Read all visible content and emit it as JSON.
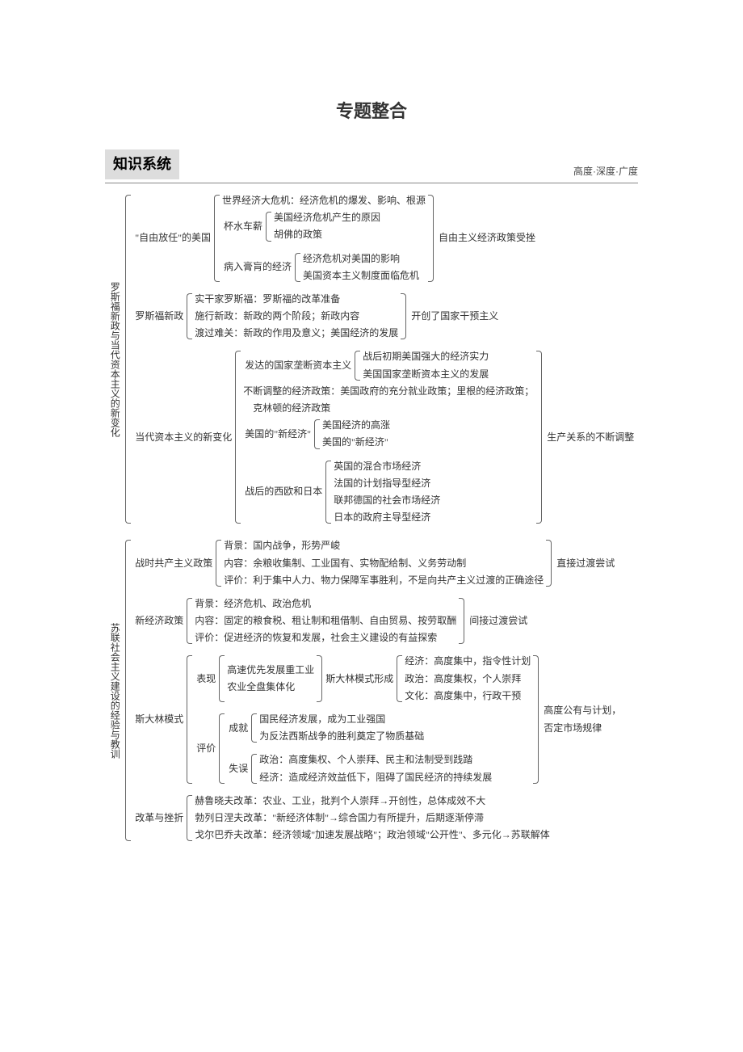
{
  "title": "专题整合",
  "section": {
    "label": "知识系统",
    "sub": "高度·深度·广度"
  },
  "us": {
    "root": "罗斯福新政与当代资本主义的新变化",
    "laissez": {
      "label": "\"自由放任\"的美国",
      "crisis": "世界经济大危机：经济危机的爆发、影响、根源",
      "cup": {
        "label": "杯水车薪",
        "a": "美国经济危机产生的原因",
        "b": "胡佛的政策"
      },
      "sick": {
        "label": "病入膏肓的经济",
        "a": "经济危机对美国的影响",
        "b": "美国资本主义制度面临危机"
      },
      "result": "自由主义经济政策受挫"
    },
    "newdeal": {
      "label": "罗斯福新政",
      "a": "实干家罗斯福：罗斯福的改革准备",
      "b": "施行新政：新政的两个阶段；新政内容",
      "c": "渡过难关：新政的作用及意义；美国经济的发展",
      "result": "开创了国家干预主义"
    },
    "modern": {
      "label": "当代资本主义的新变化",
      "monopoly": {
        "label": "发达的国家垄断资本主义",
        "a": "战后初期美国强大的经济实力",
        "b": "美国国家垄断资本主义的发展"
      },
      "adjust": "不断调整的经济政策：美国政府的充分就业政策；里根的经济政策；",
      "clinton": "克林顿的经济政策",
      "neweco": {
        "label": "美国的\"新经济\"",
        "a": "美国经济的高涨",
        "b": "美国的\"新经济\""
      },
      "postwar": {
        "label": "战后的西欧和日本",
        "a": "英国的混合市场经济",
        "b": "法国的计划指导型经济",
        "c": "联邦德国的社会市场经济",
        "d": "日本的政府主导型经济"
      },
      "result": "生产关系的不断调整"
    }
  },
  "ussr": {
    "root": "苏联社会主义建设的经验与教训",
    "war": {
      "label": "战时共产主义政策",
      "a": "背景：国内战争，形势严峻",
      "b": "内容：余粮收集制、工业国有、实物配给制、义务劳动制",
      "c": "评价：利于集中人力、物力保障军事胜利，不是向共产主义过渡的正确途径",
      "result": "直接过渡尝试"
    },
    "nep": {
      "label": "新经济政策",
      "a": "背景：经济危机、政治危机",
      "b": "内容：固定的粮食税、租让制和租借制、自由贸易、按劳取酬",
      "c": "评价：促进经济的恢复和发展，社会主义建设的有益探索",
      "result": "间接过渡尝试"
    },
    "stalin": {
      "label": "斯大林模式",
      "manifest": {
        "label": "表现",
        "a": "高速优先发展重工业",
        "b": "农业全盘集体化",
        "mid": "斯大林模式形成",
        "e": "经济：高度集中，指令性计划",
        "p": "政治：高度集权，个人崇拜",
        "c": "文化：高度集中，行政干预"
      },
      "eval": {
        "label": "评价",
        "achv": {
          "label": "成就",
          "a": "国民经济发展，成为工业强国",
          "b": "为反法西斯战争的胜利奠定了物质基础"
        },
        "fail": {
          "label": "失误",
          "a": "政治：高度集权、个人崇拜、民主和法制受到践踏",
          "b": "经济：造成经济效益低下，阻碍了国民经济的持续发展"
        }
      },
      "result_a": "高度公有与计划，",
      "result_b": "否定市场规律"
    },
    "reform": {
      "label": "改革与挫折",
      "a": "赫鲁晓夫改革：农业、工业，批判个人崇拜→开创性，总体成效不大",
      "b": "勃列日涅夫改革：\"新经济体制\"→综合国力有所提升，后期逐渐停滞",
      "c": "戈尔巴乔夫改革：经济领域\"加速发展战略\"；政治领域\"公开性\"、多元化→苏联解体"
    }
  }
}
